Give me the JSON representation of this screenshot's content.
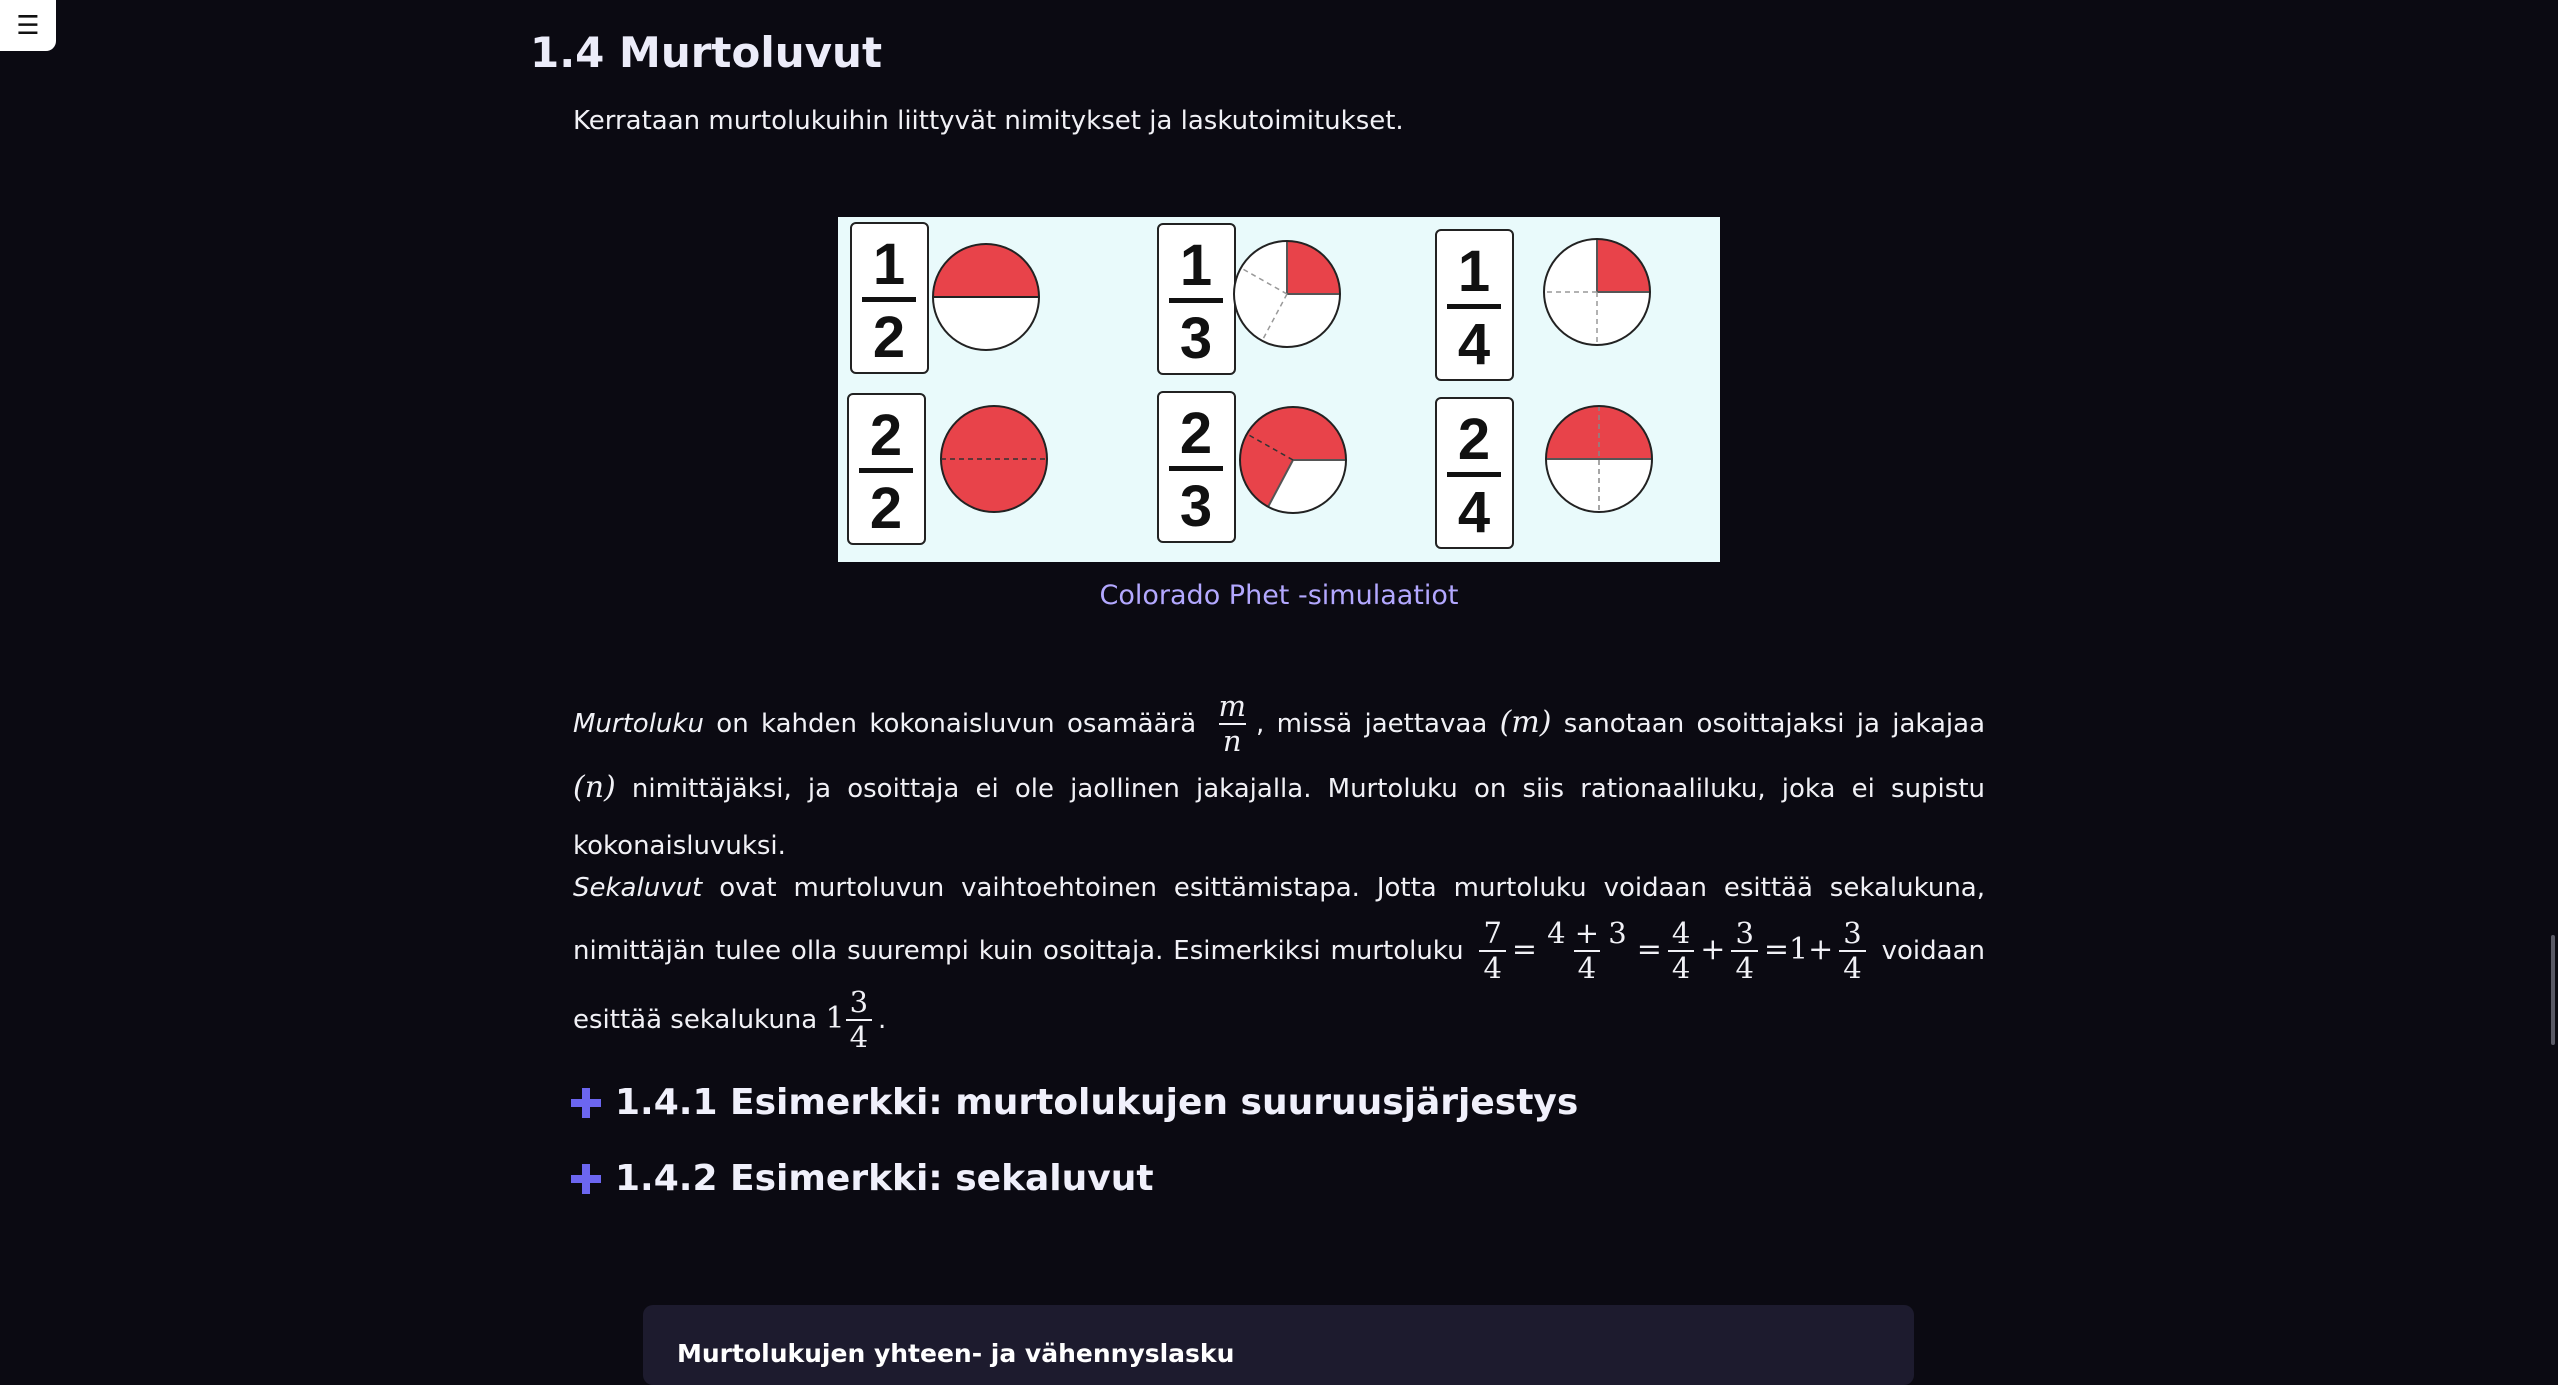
{
  "menu": {
    "icon": "hamburger-icon",
    "glyph": "☰"
  },
  "section": {
    "title": "1.4 Murtoluvut",
    "intro": "Kerrataan murtolukuihin liittyvät nimitykset ja laskutoimitukset."
  },
  "figure": {
    "caption": "Colorado Phet -simulaatiot",
    "colors": {
      "fill": "#e8434a",
      "background": "#e9fafb"
    },
    "cards": [
      {
        "num": "1",
        "den": "2"
      },
      {
        "num": "1",
        "den": "3"
      },
      {
        "num": "1",
        "den": "4"
      },
      {
        "num": "2",
        "den": "2"
      },
      {
        "num": "2",
        "den": "3"
      },
      {
        "num": "2",
        "den": "4"
      }
    ]
  },
  "para1": {
    "term": "Murtoluku",
    "t1": "on kahden kokonaisluvun osamäärä",
    "m": "m",
    "n": "n",
    "t2": ", missä jaettavaa",
    "m_paren": "(m)",
    "t3": "sanotaan osoittajaksi ja jakajaa",
    "n_paren": "(n)",
    "t4": "nimittäjäksi, ja osoittaja ei ole jaollinen jakajalla. Murtoluku on siis rationaaliluku, joka ei supistu kokonaisluvuksi."
  },
  "para2": {
    "term": "Sekaluvut",
    "t1": "ovat murtoluvun vaihtoehtoinen esittämistapa. Jotta murtoluku voidaan esittää sekalukuna, nimittäjän tulee olla suurempi kuin osoittaja. Esimerkiksi murtoluku",
    "f1n": "7",
    "f1d": "4",
    "eq": "=",
    "f2n": "4 + 3",
    "f2d": "4",
    "f3n": "4",
    "f3d": "4",
    "plus": "+",
    "f4n": "3",
    "f4d": "4",
    "one": "1",
    "f5n": "3",
    "f5d": "4",
    "t2": "voidaan esittää sekalukuna",
    "mixed_whole": "1",
    "mixed_num": "3",
    "mixed_den": "4",
    "end": "."
  },
  "examples": [
    {
      "label": "1.4.1 Esimerkki: murtolukujen suuruusjärjestys"
    },
    {
      "label": "1.4.2 Esimerkki: sekaluvut"
    }
  ],
  "card": {
    "title": "Murtolukujen yhteen- ja vähennyslasku"
  }
}
